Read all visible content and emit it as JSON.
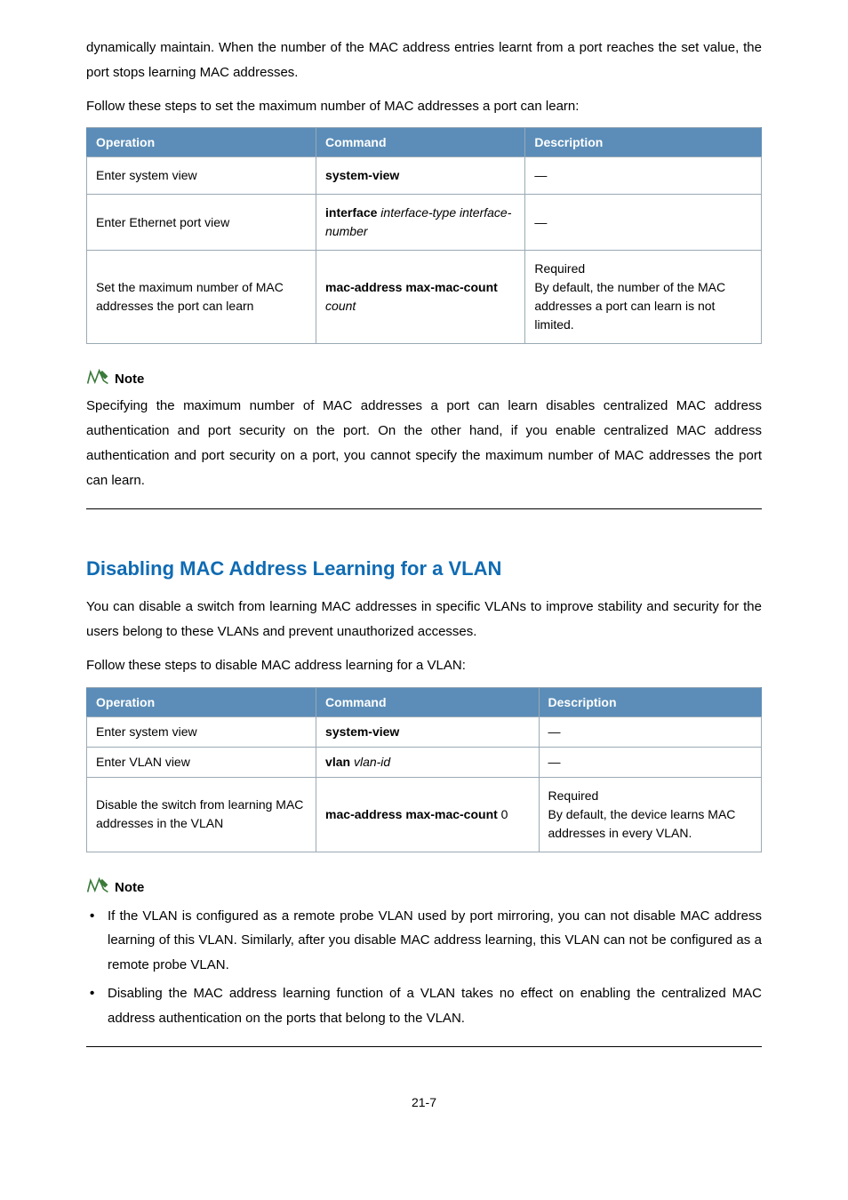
{
  "intro": {
    "p1": "dynamically maintain. When the number of the MAC address entries learnt from a port reaches the set value, the port stops learning MAC addresses.",
    "p2": "Follow these steps to set the maximum number of MAC addresses a port can learn:"
  },
  "table1": {
    "headers": {
      "op": "Operation",
      "cmd": "Command",
      "desc": "Description"
    },
    "rows": [
      {
        "op": "Enter system view",
        "cmd_bold": "system-view",
        "desc": "—"
      },
      {
        "op": "Enter Ethernet port view",
        "cmd_bold": "interface",
        "cmd_args": " interface-type interface-number",
        "desc": "—"
      },
      {
        "op": "Set the maximum number of MAC addresses the port can learn",
        "cmd_bold": "mac-address max-mac-count",
        "cmd_args": " count",
        "desc_line1": "Required",
        "desc_line2": "By default, the number of the MAC addresses a port can learn is not limited."
      }
    ]
  },
  "note1": {
    "label": "Note",
    "body": "Specifying the maximum number of MAC addresses a port can learn disables centralized MAC address authentication and port security on the port. On the other hand, if you enable centralized MAC address authentication and port security on a port, you cannot specify the maximum number of MAC addresses the port can learn."
  },
  "section": {
    "title": "Disabling MAC Address Learning for a VLAN",
    "p1": "You can disable a switch from learning MAC addresses in specific VLANs to improve stability and security for the users belong to these VLANs and prevent unauthorized accesses.",
    "p2": "Follow these steps to disable MAC address learning for a VLAN:"
  },
  "table2": {
    "headers": {
      "op": "Operation",
      "cmd": "Command",
      "desc": "Description"
    },
    "rows": [
      {
        "op": "Enter system view",
        "cmd_bold": "system-view",
        "desc": "—"
      },
      {
        "op": "Enter VLAN view",
        "cmd_bold": "vlan",
        "cmd_args": " vlan-id",
        "desc": "—"
      },
      {
        "op": "Disable the switch from learning MAC addresses in the VLAN",
        "cmd_bold": "mac-address max-mac-count",
        "cmd_tail": " 0",
        "desc_line1": "Required",
        "desc_line2": "By default, the device learns MAC addresses in every VLAN."
      }
    ]
  },
  "note2": {
    "label": "Note",
    "items": [
      "If the VLAN is configured as a remote probe VLAN used by port mirroring, you can not disable MAC address learning of this VLAN. Similarly, after you disable MAC address learning, this VLAN can not be configured as a remote probe VLAN.",
      "Disabling the MAC address learning function of a VLAN takes no effect on enabling the centralized MAC address authentication on the ports that belong to the VLAN."
    ]
  },
  "page_number": "21-7"
}
